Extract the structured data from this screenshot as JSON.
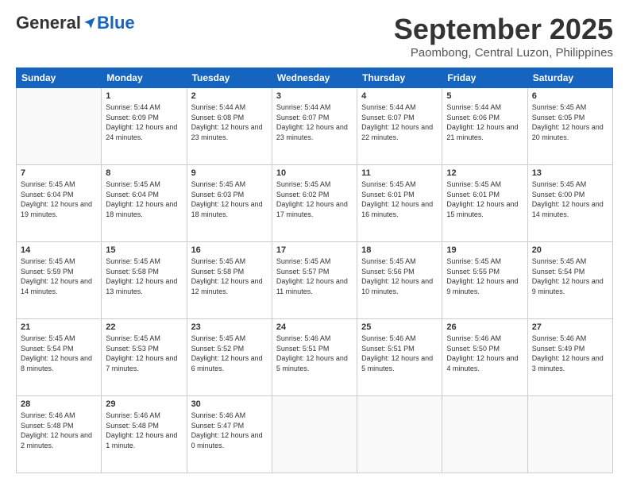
{
  "header": {
    "logo_general": "General",
    "logo_blue": "Blue",
    "month_title": "September 2025",
    "subtitle": "Paombong, Central Luzon, Philippines"
  },
  "weekdays": [
    "Sunday",
    "Monday",
    "Tuesday",
    "Wednesday",
    "Thursday",
    "Friday",
    "Saturday"
  ],
  "weeks": [
    [
      {
        "day": "",
        "sunrise": "",
        "sunset": "",
        "daylight": ""
      },
      {
        "day": "1",
        "sunrise": "Sunrise: 5:44 AM",
        "sunset": "Sunset: 6:09 PM",
        "daylight": "Daylight: 12 hours and 24 minutes."
      },
      {
        "day": "2",
        "sunrise": "Sunrise: 5:44 AM",
        "sunset": "Sunset: 6:08 PM",
        "daylight": "Daylight: 12 hours and 23 minutes."
      },
      {
        "day": "3",
        "sunrise": "Sunrise: 5:44 AM",
        "sunset": "Sunset: 6:07 PM",
        "daylight": "Daylight: 12 hours and 23 minutes."
      },
      {
        "day": "4",
        "sunrise": "Sunrise: 5:44 AM",
        "sunset": "Sunset: 6:07 PM",
        "daylight": "Daylight: 12 hours and 22 minutes."
      },
      {
        "day": "5",
        "sunrise": "Sunrise: 5:44 AM",
        "sunset": "Sunset: 6:06 PM",
        "daylight": "Daylight: 12 hours and 21 minutes."
      },
      {
        "day": "6",
        "sunrise": "Sunrise: 5:45 AM",
        "sunset": "Sunset: 6:05 PM",
        "daylight": "Daylight: 12 hours and 20 minutes."
      }
    ],
    [
      {
        "day": "7",
        "sunrise": "Sunrise: 5:45 AM",
        "sunset": "Sunset: 6:04 PM",
        "daylight": "Daylight: 12 hours and 19 minutes."
      },
      {
        "day": "8",
        "sunrise": "Sunrise: 5:45 AM",
        "sunset": "Sunset: 6:04 PM",
        "daylight": "Daylight: 12 hours and 18 minutes."
      },
      {
        "day": "9",
        "sunrise": "Sunrise: 5:45 AM",
        "sunset": "Sunset: 6:03 PM",
        "daylight": "Daylight: 12 hours and 18 minutes."
      },
      {
        "day": "10",
        "sunrise": "Sunrise: 5:45 AM",
        "sunset": "Sunset: 6:02 PM",
        "daylight": "Daylight: 12 hours and 17 minutes."
      },
      {
        "day": "11",
        "sunrise": "Sunrise: 5:45 AM",
        "sunset": "Sunset: 6:01 PM",
        "daylight": "Daylight: 12 hours and 16 minutes."
      },
      {
        "day": "12",
        "sunrise": "Sunrise: 5:45 AM",
        "sunset": "Sunset: 6:01 PM",
        "daylight": "Daylight: 12 hours and 15 minutes."
      },
      {
        "day": "13",
        "sunrise": "Sunrise: 5:45 AM",
        "sunset": "Sunset: 6:00 PM",
        "daylight": "Daylight: 12 hours and 14 minutes."
      }
    ],
    [
      {
        "day": "14",
        "sunrise": "Sunrise: 5:45 AM",
        "sunset": "Sunset: 5:59 PM",
        "daylight": "Daylight: 12 hours and 14 minutes."
      },
      {
        "day": "15",
        "sunrise": "Sunrise: 5:45 AM",
        "sunset": "Sunset: 5:58 PM",
        "daylight": "Daylight: 12 hours and 13 minutes."
      },
      {
        "day": "16",
        "sunrise": "Sunrise: 5:45 AM",
        "sunset": "Sunset: 5:58 PM",
        "daylight": "Daylight: 12 hours and 12 minutes."
      },
      {
        "day": "17",
        "sunrise": "Sunrise: 5:45 AM",
        "sunset": "Sunset: 5:57 PM",
        "daylight": "Daylight: 12 hours and 11 minutes."
      },
      {
        "day": "18",
        "sunrise": "Sunrise: 5:45 AM",
        "sunset": "Sunset: 5:56 PM",
        "daylight": "Daylight: 12 hours and 10 minutes."
      },
      {
        "day": "19",
        "sunrise": "Sunrise: 5:45 AM",
        "sunset": "Sunset: 5:55 PM",
        "daylight": "Daylight: 12 hours and 9 minutes."
      },
      {
        "day": "20",
        "sunrise": "Sunrise: 5:45 AM",
        "sunset": "Sunset: 5:54 PM",
        "daylight": "Daylight: 12 hours and 9 minutes."
      }
    ],
    [
      {
        "day": "21",
        "sunrise": "Sunrise: 5:45 AM",
        "sunset": "Sunset: 5:54 PM",
        "daylight": "Daylight: 12 hours and 8 minutes."
      },
      {
        "day": "22",
        "sunrise": "Sunrise: 5:45 AM",
        "sunset": "Sunset: 5:53 PM",
        "daylight": "Daylight: 12 hours and 7 minutes."
      },
      {
        "day": "23",
        "sunrise": "Sunrise: 5:45 AM",
        "sunset": "Sunset: 5:52 PM",
        "daylight": "Daylight: 12 hours and 6 minutes."
      },
      {
        "day": "24",
        "sunrise": "Sunrise: 5:46 AM",
        "sunset": "Sunset: 5:51 PM",
        "daylight": "Daylight: 12 hours and 5 minutes."
      },
      {
        "day": "25",
        "sunrise": "Sunrise: 5:46 AM",
        "sunset": "Sunset: 5:51 PM",
        "daylight": "Daylight: 12 hours and 5 minutes."
      },
      {
        "day": "26",
        "sunrise": "Sunrise: 5:46 AM",
        "sunset": "Sunset: 5:50 PM",
        "daylight": "Daylight: 12 hours and 4 minutes."
      },
      {
        "day": "27",
        "sunrise": "Sunrise: 5:46 AM",
        "sunset": "Sunset: 5:49 PM",
        "daylight": "Daylight: 12 hours and 3 minutes."
      }
    ],
    [
      {
        "day": "28",
        "sunrise": "Sunrise: 5:46 AM",
        "sunset": "Sunset: 5:48 PM",
        "daylight": "Daylight: 12 hours and 2 minutes."
      },
      {
        "day": "29",
        "sunrise": "Sunrise: 5:46 AM",
        "sunset": "Sunset: 5:48 PM",
        "daylight": "Daylight: 12 hours and 1 minute."
      },
      {
        "day": "30",
        "sunrise": "Sunrise: 5:46 AM",
        "sunset": "Sunset: 5:47 PM",
        "daylight": "Daylight: 12 hours and 0 minutes."
      },
      {
        "day": "",
        "sunrise": "",
        "sunset": "",
        "daylight": ""
      },
      {
        "day": "",
        "sunrise": "",
        "sunset": "",
        "daylight": ""
      },
      {
        "day": "",
        "sunrise": "",
        "sunset": "",
        "daylight": ""
      },
      {
        "day": "",
        "sunrise": "",
        "sunset": "",
        "daylight": ""
      }
    ]
  ]
}
